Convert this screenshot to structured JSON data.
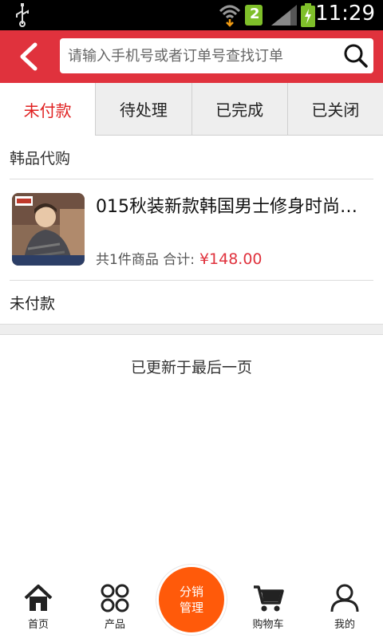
{
  "status_bar": {
    "time": "11:29",
    "sim_badge": "2"
  },
  "header": {
    "search_placeholder": "请输入手机号或者订单号查找订单"
  },
  "tabs": [
    {
      "label": "未付款",
      "active": true
    },
    {
      "label": "待处理",
      "active": false
    },
    {
      "label": "已完成",
      "active": false
    },
    {
      "label": "已关闭",
      "active": false
    }
  ],
  "order": {
    "store_name": "韩品代购",
    "product_title": "015秋装新款韩国男士修身时尚…",
    "count_text": "共1件商品 合计:",
    "price": "¥148.00",
    "status": "未付款"
  },
  "list_end_text": "已更新于最后一页",
  "bottom_nav": {
    "home": "首页",
    "products": "产品",
    "center_line1": "分销",
    "center_line2": "管理",
    "cart": "购物车",
    "mine": "我的"
  },
  "colors": {
    "accent": "#e0323d",
    "center_button": "#ff5a0a",
    "active_tab_text": "#e02020"
  }
}
